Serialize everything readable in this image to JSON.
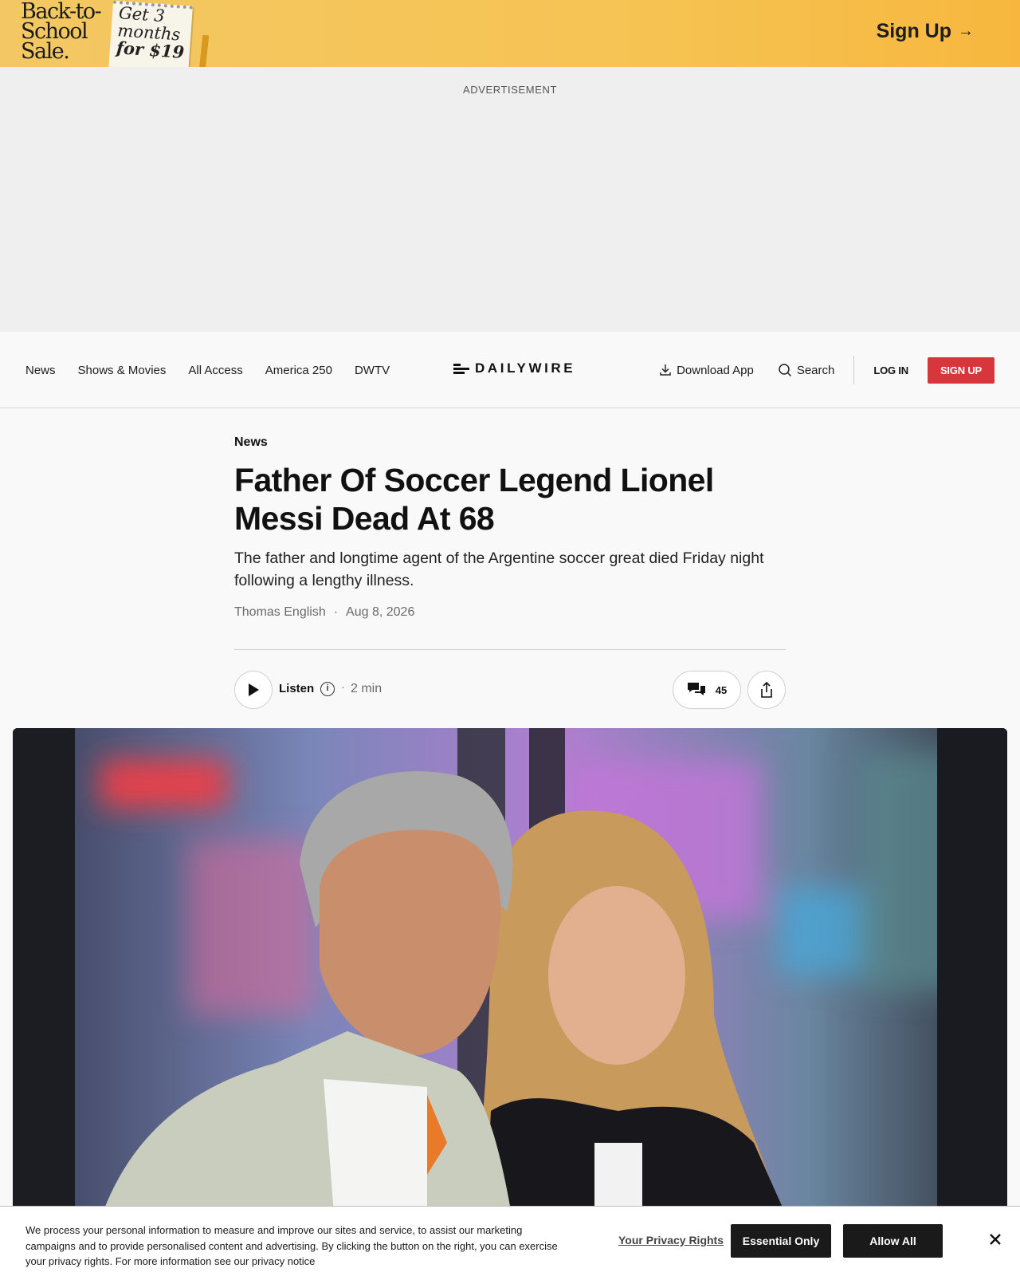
{
  "promo": {
    "title_lines": [
      "Back-to-",
      "School",
      "Sale."
    ],
    "card_lines": [
      "Get 3",
      "months",
      "for $19"
    ],
    "signup_label": "Sign Up",
    "arrow": "→"
  },
  "ad": {
    "label": "ADVERTISEMENT"
  },
  "nav": {
    "links": [
      "News",
      "Shows & Movies",
      "All Access",
      "America 250",
      "DWTV"
    ],
    "logo_text": "DAILYWIRE",
    "download_label": "Download App",
    "search_label": "Search",
    "login_label": "LOG IN",
    "signup_label": "SIGN UP"
  },
  "article": {
    "category": "News",
    "headline": "Father Of Soccer Legend Lionel Messi Dead At 68",
    "dek": "The father and longtime agent of the Argentine soccer great died Friday night following a lengthy illness.",
    "author": "Thomas English",
    "separator": "·",
    "date": "Aug 8, 2026",
    "listen_label": "Listen",
    "info_glyph": "i",
    "read_time": "2 min",
    "comment_count": "45"
  },
  "hero": {
    "alt": ""
  },
  "cookie": {
    "text": "We process your personal information to measure and improve our sites and service, to assist our marketing campaigns and to provide personalised content and advertising. By clicking the button on the right, you can exercise your privacy rights. For more information see our privacy notice",
    "privacy_link": "Your Privacy Rights",
    "essential_label": "Essential Only",
    "allow_label": "Allow All"
  },
  "colors": {
    "promo_bg": "#f6c454",
    "signup_red": "#d7373c",
    "dark_button": "#1a1a1a"
  },
  "icons": [
    "download-icon",
    "search-icon",
    "play-icon",
    "info-icon",
    "comments-icon",
    "share-icon",
    "close-icon"
  ]
}
